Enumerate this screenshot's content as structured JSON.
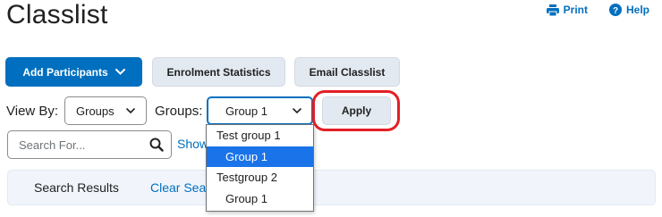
{
  "page": {
    "title": "Classlist"
  },
  "top_links": [
    {
      "label": "Print",
      "icon": "printer-icon"
    },
    {
      "label": "Help",
      "icon": "help-icon"
    }
  ],
  "toolbar": {
    "add_participants_label": "Add Participants",
    "enrolment_statistics_label": "Enrolment Statistics",
    "email_classlist_label": "Email Classlist"
  },
  "filters": {
    "view_by_label": "View By:",
    "view_by_value": "Groups",
    "groups_label": "Groups:",
    "groups_value": "Group 1",
    "apply_label": "Apply"
  },
  "groups_dropdown": {
    "options": [
      {
        "label": "Test group 1",
        "kind": "group"
      },
      {
        "label": "Group 1",
        "kind": "child",
        "selected": true
      },
      {
        "label": "Testgroup 2",
        "kind": "group"
      },
      {
        "label": "Group 1",
        "kind": "child"
      }
    ]
  },
  "search": {
    "placeholder": "Search For...",
    "show_link_partial": "Show"
  },
  "results": {
    "label": "Search Results",
    "clear_link_partial": "Clear Sea"
  },
  "colors": {
    "primary": "#006fbf",
    "highlight_ring": "#e31f26",
    "selected_option": "#1a73e8"
  }
}
